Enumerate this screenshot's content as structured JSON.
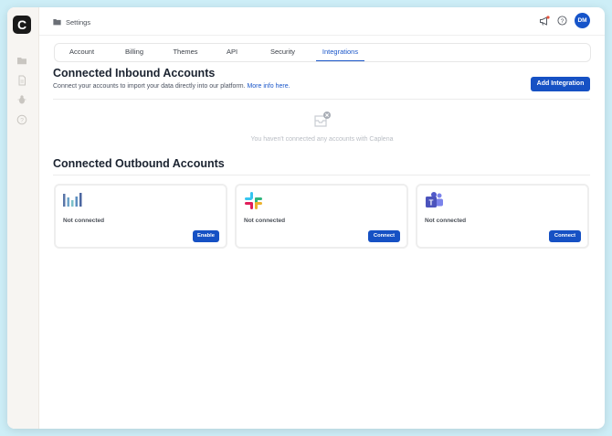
{
  "sidebar": {
    "logo_letter": "C",
    "icons": [
      "folder-icon",
      "document-icon",
      "bug-icon",
      "help-circle-icon"
    ]
  },
  "topbar": {
    "breadcrumb": "Settings",
    "avatar_initials": "DM"
  },
  "tabs": [
    {
      "label": "Account",
      "active": false
    },
    {
      "label": "Billing",
      "active": false
    },
    {
      "label": "Themes",
      "active": false
    },
    {
      "label": "API",
      "active": false
    },
    {
      "label": "Security",
      "active": false
    },
    {
      "label": "Integrations",
      "active": true
    }
  ],
  "inbound": {
    "title": "Connected Inbound Accounts",
    "subtitle": "Connect your accounts to import your data directly into our platform.",
    "more_info": "More info here.",
    "add_button": "Add Integration",
    "empty_text": "You haven't connected any accounts with Caplena"
  },
  "outbound": {
    "title": "Connected Outbound Accounts",
    "cards": [
      {
        "logo": "mentimeter-logo-icon",
        "status": "Not connected",
        "button": "Enable"
      },
      {
        "logo": "slack-logo-icon",
        "status": "Not connected",
        "button": "Connect"
      },
      {
        "logo": "teams-logo-icon",
        "status": "Not connected",
        "button": "Connect"
      }
    ]
  },
  "colors": {
    "accent": "#1651c4",
    "background": "#cdeef7",
    "notification_dot": "#e5533d"
  }
}
